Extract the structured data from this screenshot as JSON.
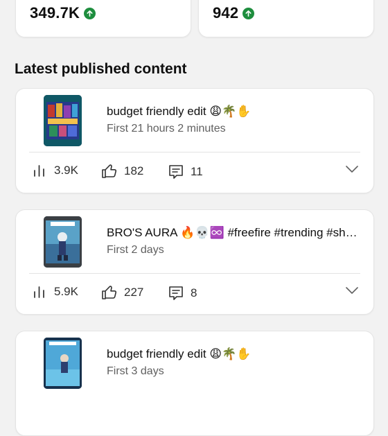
{
  "stats": [
    {
      "value": "349.7K",
      "trend_icon": "arrow-up-icon",
      "trend_color": "#1e8e3e"
    },
    {
      "value": "942",
      "trend_icon": "arrow-up-icon",
      "trend_color": "#1e8e3e"
    }
  ],
  "section": {
    "title": "Latest published content"
  },
  "items": [
    {
      "title": "budget friendly edit 😩🌴✋",
      "subtitle": "First 21 hours 2 minutes",
      "views": "3.9K",
      "likes": "182",
      "comments": "11"
    },
    {
      "title": "BRO'S AURA 🔥💀♾️ #freefire #trending #shorts",
      "subtitle": "First 2 days",
      "views": "5.9K",
      "likes": "227",
      "comments": "8"
    },
    {
      "title": "budget friendly edit 😩🌴✋",
      "subtitle": "First 3 days",
      "views": "",
      "likes": "",
      "comments": ""
    }
  ],
  "icons": {
    "views": "bar-chart-icon",
    "likes": "thumbs-up-icon",
    "comments": "comment-icon",
    "expand": "chevron-down-icon"
  }
}
